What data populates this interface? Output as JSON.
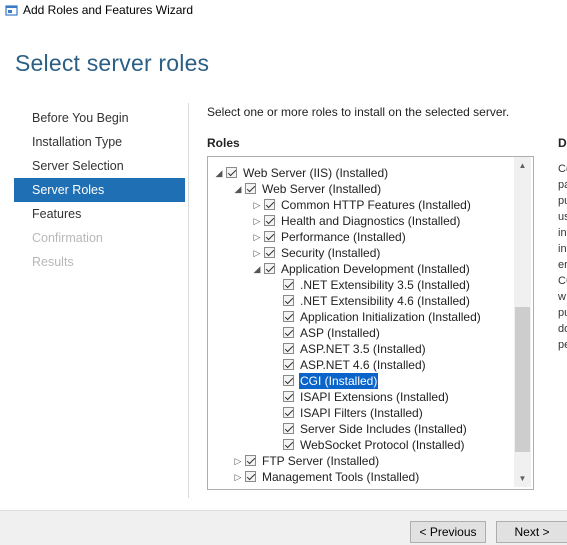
{
  "window": {
    "title": "Add Roles and Features Wizard"
  },
  "page": {
    "title": "Select server roles",
    "instruction": "Select one or more roles to install on the selected server.",
    "roles_label": "Roles",
    "description_label": "De",
    "description_fragments": [
      "Co",
      "pa",
      "pu",
      "us",
      "in",
      "in",
      "er",
      "CG",
      "w",
      "pu",
      "do",
      "pe"
    ]
  },
  "nav": {
    "items": [
      {
        "label": "Before You Begin",
        "state": "normal"
      },
      {
        "label": "Installation Type",
        "state": "normal"
      },
      {
        "label": "Server Selection",
        "state": "normal"
      },
      {
        "label": "Server Roles",
        "state": "active"
      },
      {
        "label": "Features",
        "state": "normal"
      },
      {
        "label": "Confirmation",
        "state": "disabled"
      },
      {
        "label": "Results",
        "state": "disabled"
      }
    ]
  },
  "roles": {
    "items": [
      {
        "label": "Web Server (IIS) (Installed)",
        "level": 0,
        "expander": "expanded",
        "checked": true
      },
      {
        "label": "Web Server (Installed)",
        "level": 1,
        "expander": "expanded",
        "checked": true
      },
      {
        "label": "Common HTTP Features (Installed)",
        "level": 2,
        "expander": "collapsed",
        "checked": true
      },
      {
        "label": "Health and Diagnostics (Installed)",
        "level": 2,
        "expander": "collapsed",
        "checked": true
      },
      {
        "label": "Performance (Installed)",
        "level": 2,
        "expander": "collapsed",
        "checked": true
      },
      {
        "label": "Security (Installed)",
        "level": 2,
        "expander": "collapsed",
        "checked": true
      },
      {
        "label": "Application Development (Installed)",
        "level": 2,
        "expander": "expanded",
        "checked": true
      },
      {
        "label": ".NET Extensibility 3.5 (Installed)",
        "level": 3,
        "expander": "none",
        "checked": true
      },
      {
        "label": ".NET Extensibility 4.6 (Installed)",
        "level": 3,
        "expander": "none",
        "checked": true
      },
      {
        "label": "Application Initialization (Installed)",
        "level": 3,
        "expander": "none",
        "checked": true
      },
      {
        "label": "ASP (Installed)",
        "level": 3,
        "expander": "none",
        "checked": true
      },
      {
        "label": "ASP.NET 3.5 (Installed)",
        "level": 3,
        "expander": "none",
        "checked": true
      },
      {
        "label": "ASP.NET 4.6 (Installed)",
        "level": 3,
        "expander": "none",
        "checked": true
      },
      {
        "label": "CGI (Installed)",
        "level": 3,
        "expander": "none",
        "checked": true,
        "selected": true
      },
      {
        "label": "ISAPI Extensions (Installed)",
        "level": 3,
        "expander": "none",
        "checked": true
      },
      {
        "label": "ISAPI Filters (Installed)",
        "level": 3,
        "expander": "none",
        "checked": true
      },
      {
        "label": "Server Side Includes (Installed)",
        "level": 3,
        "expander": "none",
        "checked": true
      },
      {
        "label": "WebSocket Protocol (Installed)",
        "level": 3,
        "expander": "none",
        "checked": true
      },
      {
        "label": "FTP Server (Installed)",
        "level": 1,
        "expander": "collapsed",
        "checked": true
      },
      {
        "label": "Management Tools (Installed)",
        "level": 1,
        "expander": "collapsed",
        "checked": true
      }
    ]
  },
  "icons": {
    "expanded": "◢",
    "collapsed": "▷",
    "scroll_up": "▲",
    "scroll_down": "▼"
  },
  "buttons": {
    "previous": "< Previous",
    "next": "Next >"
  },
  "colors": {
    "title": "#2b5f86",
    "nav_active": "#1f6fb5",
    "selection": "#0a64c9"
  }
}
